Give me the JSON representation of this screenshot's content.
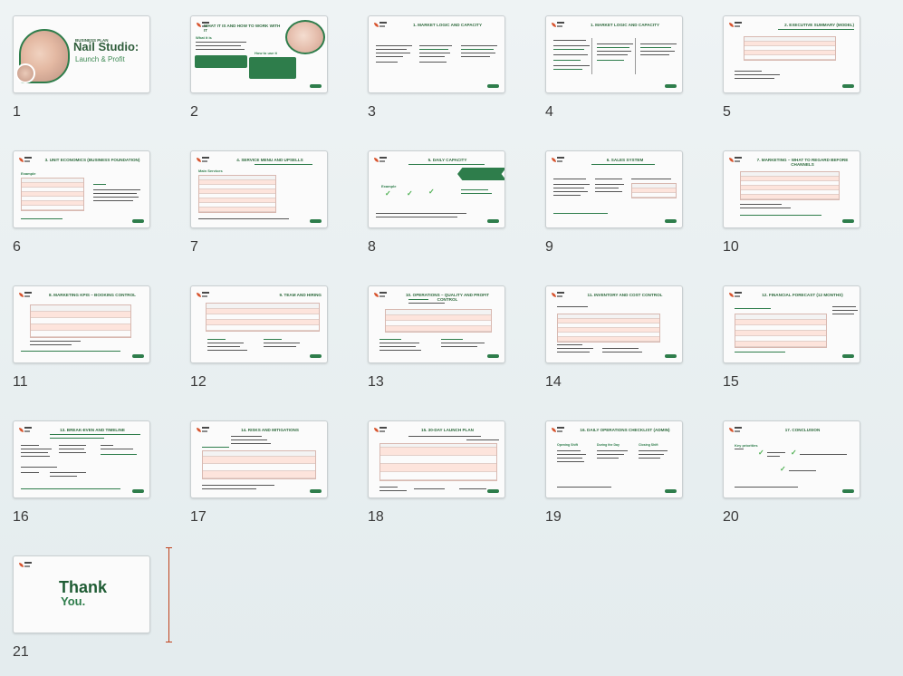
{
  "colors": {
    "accent_green": "#2e7d4b",
    "title_green": "#2f5d3b",
    "table_pink": "#fde4dc",
    "insert_marker": "#c0421c"
  },
  "slides": [
    {
      "number": "1",
      "title": "Nail Studio:",
      "subtitle": "Launch & Profit",
      "kicker": "BUSINESS PLAN"
    },
    {
      "number": "2",
      "title": "WHAT IT IS AND HOW TO WORK WITH IT",
      "box1": "What it is",
      "box2": "How to use it"
    },
    {
      "number": "3",
      "title": "1. MARKET LOGIC AND CAPACITY"
    },
    {
      "number": "4",
      "title": "1. MARKET LOGIC AND CAPACITY"
    },
    {
      "number": "5",
      "title": "2. EXECUTIVE SUMMARY (MODEL)"
    },
    {
      "number": "6",
      "title": "3. UNIT ECONOMICS (BUSINESS FOUNDATION)",
      "label": "Example"
    },
    {
      "number": "7",
      "title": "4. SERVICE MENU AND UPSELLS",
      "label": "Main Services"
    },
    {
      "number": "8",
      "title": "5. DAILY CAPACITY",
      "label": "Example"
    },
    {
      "number": "9",
      "title": "6. SALES SYSTEM"
    },
    {
      "number": "10",
      "title": "7. MARKETING – WHAT TO REGARD BEFORE CHANNELS"
    },
    {
      "number": "11",
      "title": "8. MARKETING KPIs – BOOKING CONTROL"
    },
    {
      "number": "12",
      "title": "9. TEAM AND HIRING"
    },
    {
      "number": "13",
      "title": "10. OPERATIONS – QUALITY AND PROFIT CONTROL"
    },
    {
      "number": "14",
      "title": "11. INVENTORY AND COST CONTROL"
    },
    {
      "number": "15",
      "title": "12. FINANCIAL FORECAST (12 MONTHS)"
    },
    {
      "number": "16",
      "title": "13. BREAK-EVEN AND TIMELINE"
    },
    {
      "number": "17",
      "title": "14. RISKS AND MITIGATIONS"
    },
    {
      "number": "18",
      "title": "15. 30-DAY LAUNCH PLAN"
    },
    {
      "number": "19",
      "title": "16. DAILY OPERATIONS CHECKLIST (ADMIN)",
      "cols": [
        "Opening Shift",
        "During the Day",
        "Closing Shift"
      ]
    },
    {
      "number": "20",
      "title": "17. CONCLUSION",
      "label": "Key priorities"
    },
    {
      "number": "21",
      "title": "Thank",
      "subtitle": "You."
    }
  ]
}
